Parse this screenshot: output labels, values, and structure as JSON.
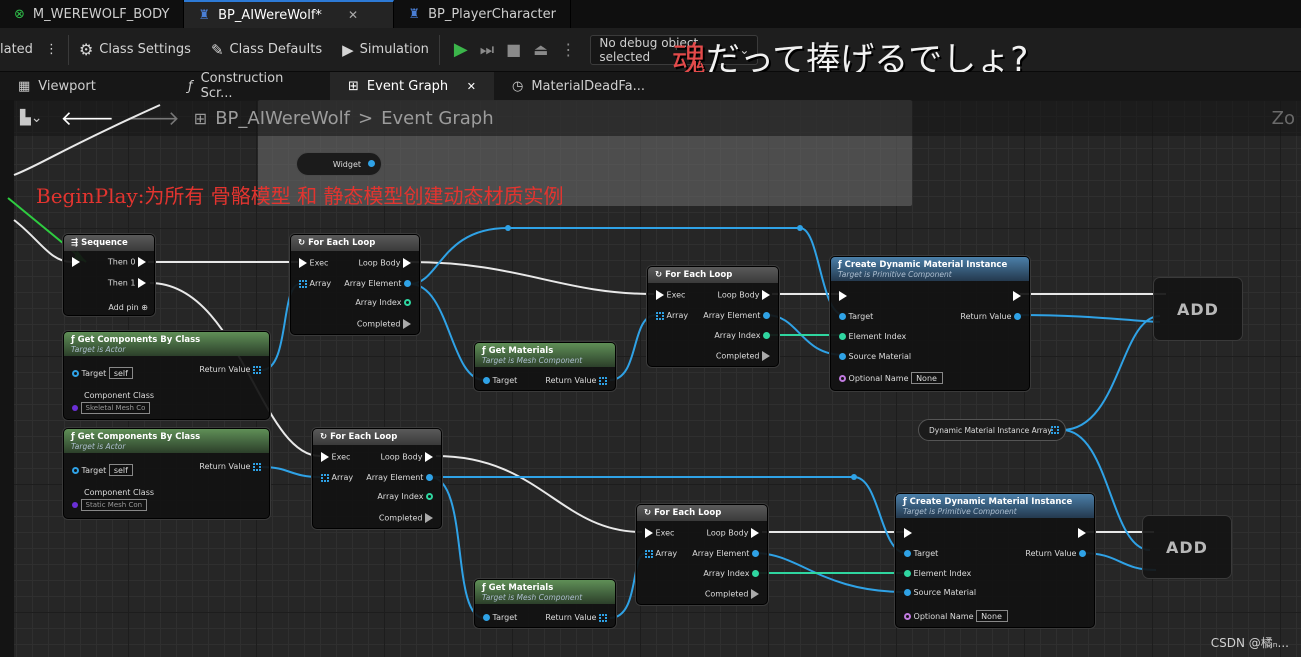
{
  "doc_tabs": [
    {
      "label": "M_WEREWOLF_BODY",
      "icon": "material-icon",
      "active": false
    },
    {
      "label": "BP_AIWereWolf*",
      "icon": "blueprint-icon",
      "active": true,
      "close": "✕"
    },
    {
      "label": "BP_PlayerCharacter",
      "icon": "blueprint-icon",
      "active": false
    }
  ],
  "toolbar": {
    "compile": "lated",
    "class_settings": "Class Settings",
    "class_defaults": "Class Defaults",
    "simulation": "Simulation",
    "debug_filter": "No debug object selected"
  },
  "overlay_text": {
    "red_char": "魂",
    "rest": "だって捧げるでしょ?"
  },
  "panel_tabs": [
    {
      "label": "Viewport",
      "icon": "grid-icon"
    },
    {
      "label": "Construction Scr...",
      "icon": "function-icon"
    },
    {
      "label": "Event Graph",
      "icon": "graph-icon",
      "active": true,
      "close": "✕"
    },
    {
      "label": "MaterialDeadFa...",
      "icon": "clock-icon"
    }
  ],
  "breadcrumb": {
    "blueprint": "BP_AIWereWolf",
    "separator": ">",
    "graph": "Event Graph"
  },
  "zoom_label": "Zo",
  "comment_note": "BeginPlay:为所有 骨骼模型 和 静态模型创建动态材质实例",
  "widget_pin": "Widget",
  "dmia_var": "Dynamic Material Instance Array",
  "nodes": {
    "sequence": {
      "title": "Sequence",
      "then0": "Then 0",
      "then1": "Then 1",
      "add_pin": "Add pin"
    },
    "gcbc1": {
      "title": "Get Components By Class",
      "sub": "Target is Actor",
      "target": "Target",
      "self": "self",
      "return": "Return Value",
      "component_class": "Component Class",
      "class_value": "Skeletal Mesh Co"
    },
    "gcbc2": {
      "title": "Get Components By Class",
      "sub": "Target is Actor",
      "target": "Target",
      "self": "self",
      "return": "Return Value",
      "component_class": "Component Class",
      "class_value": "Static Mesh Con"
    },
    "foreach": {
      "title": "For Each Loop",
      "exec": "Exec",
      "array": "Array",
      "loop_body": "Loop Body",
      "array_element": "Array Element",
      "array_index": "Array Index",
      "completed": "Completed"
    },
    "getmat": {
      "title": "Get Materials",
      "sub": "Target is Mesh Component",
      "target": "Target",
      "return": "Return Value"
    },
    "cdmi": {
      "title": "Create Dynamic Material Instance",
      "sub": "Target is Primitive Component",
      "target": "Target",
      "element_index": "Element Index",
      "source_material": "Source Material",
      "optional_name": "Optional Name",
      "none": "None",
      "return": "Return Value"
    },
    "add": "ADD"
  },
  "watermark": "CSDN @橘ₙ..."
}
